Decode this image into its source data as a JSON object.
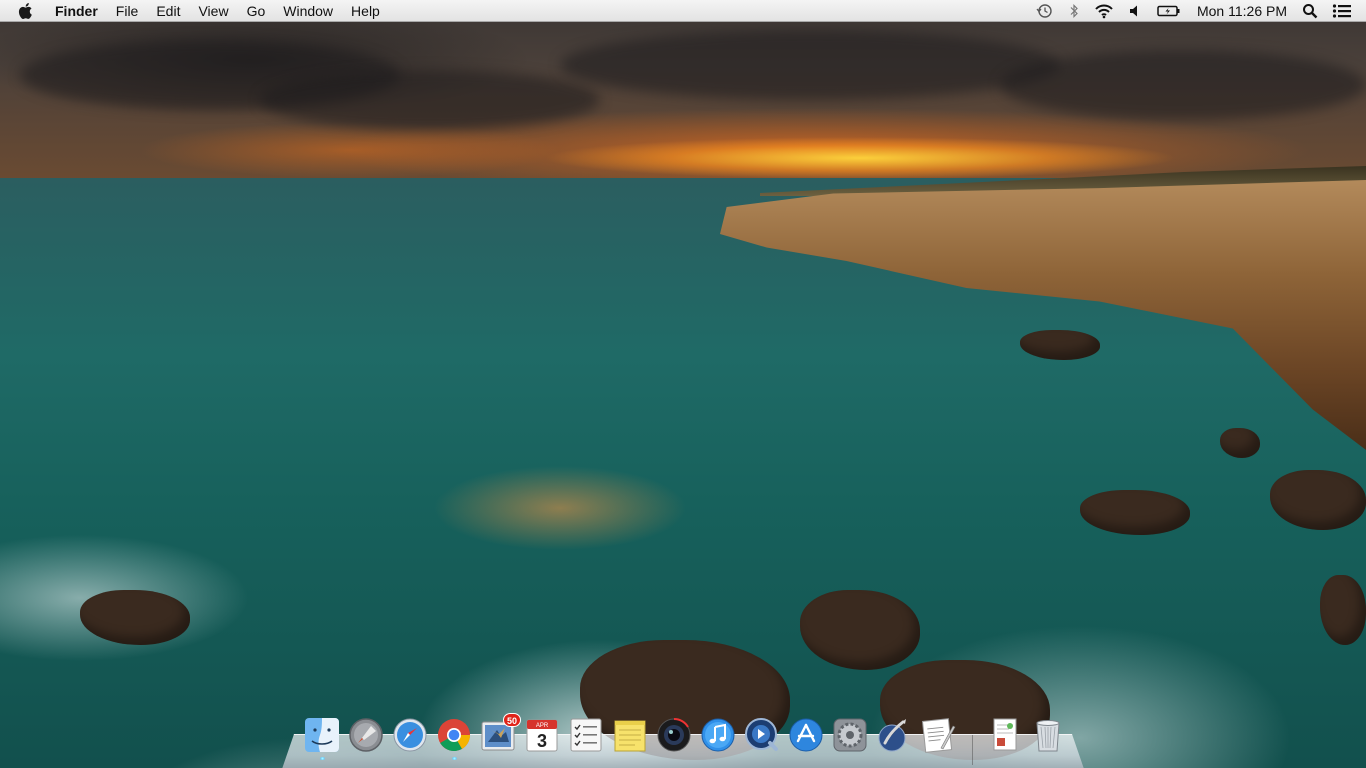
{
  "menubar": {
    "apple_icon": "apple-logo-icon",
    "app_name": "Finder",
    "menus": [
      "File",
      "Edit",
      "View",
      "Go",
      "Window",
      "Help"
    ],
    "status_icons": [
      "time-machine-icon",
      "bluetooth-icon",
      "wifi-icon",
      "volume-icon",
      "battery-icon"
    ],
    "clock": "Mon 11:26 PM",
    "spotlight_icon": "spotlight-search-icon",
    "notification_icon": "notification-center-icon"
  },
  "dock": {
    "items": [
      {
        "name": "finder",
        "icon": "finder-icon",
        "running": true
      },
      {
        "name": "launchpad",
        "icon": "launchpad-icon"
      },
      {
        "name": "safari",
        "icon": "safari-icon"
      },
      {
        "name": "chrome",
        "icon": "chrome-icon",
        "running": true
      },
      {
        "name": "mail",
        "icon": "mail-icon",
        "badge": "50"
      },
      {
        "name": "calendar",
        "icon": "calendar-icon",
        "date_text": "3",
        "month_text": "APR"
      },
      {
        "name": "reminders",
        "icon": "reminders-icon"
      },
      {
        "name": "stickies",
        "icon": "stickies-icon"
      },
      {
        "name": "photo-booth",
        "icon": "photo-booth-icon"
      },
      {
        "name": "itunes",
        "icon": "itunes-icon"
      },
      {
        "name": "quicktime",
        "icon": "quicktime-icon"
      },
      {
        "name": "app-store",
        "icon": "app-store-icon"
      },
      {
        "name": "system-preferences",
        "icon": "system-preferences-icon"
      },
      {
        "name": "script-editor",
        "icon": "script-editor-icon"
      },
      {
        "name": "textedit",
        "icon": "textedit-icon"
      },
      {
        "name": "documents-stack",
        "icon": "documents-stack-icon"
      },
      {
        "name": "trash",
        "icon": "trash-icon"
      }
    ]
  },
  "wallpaper": {
    "description_colors": {
      "sky": "#4a403a",
      "sun": "#ffc83a",
      "sea": "#17615c",
      "cliff": "#8e6438"
    }
  }
}
